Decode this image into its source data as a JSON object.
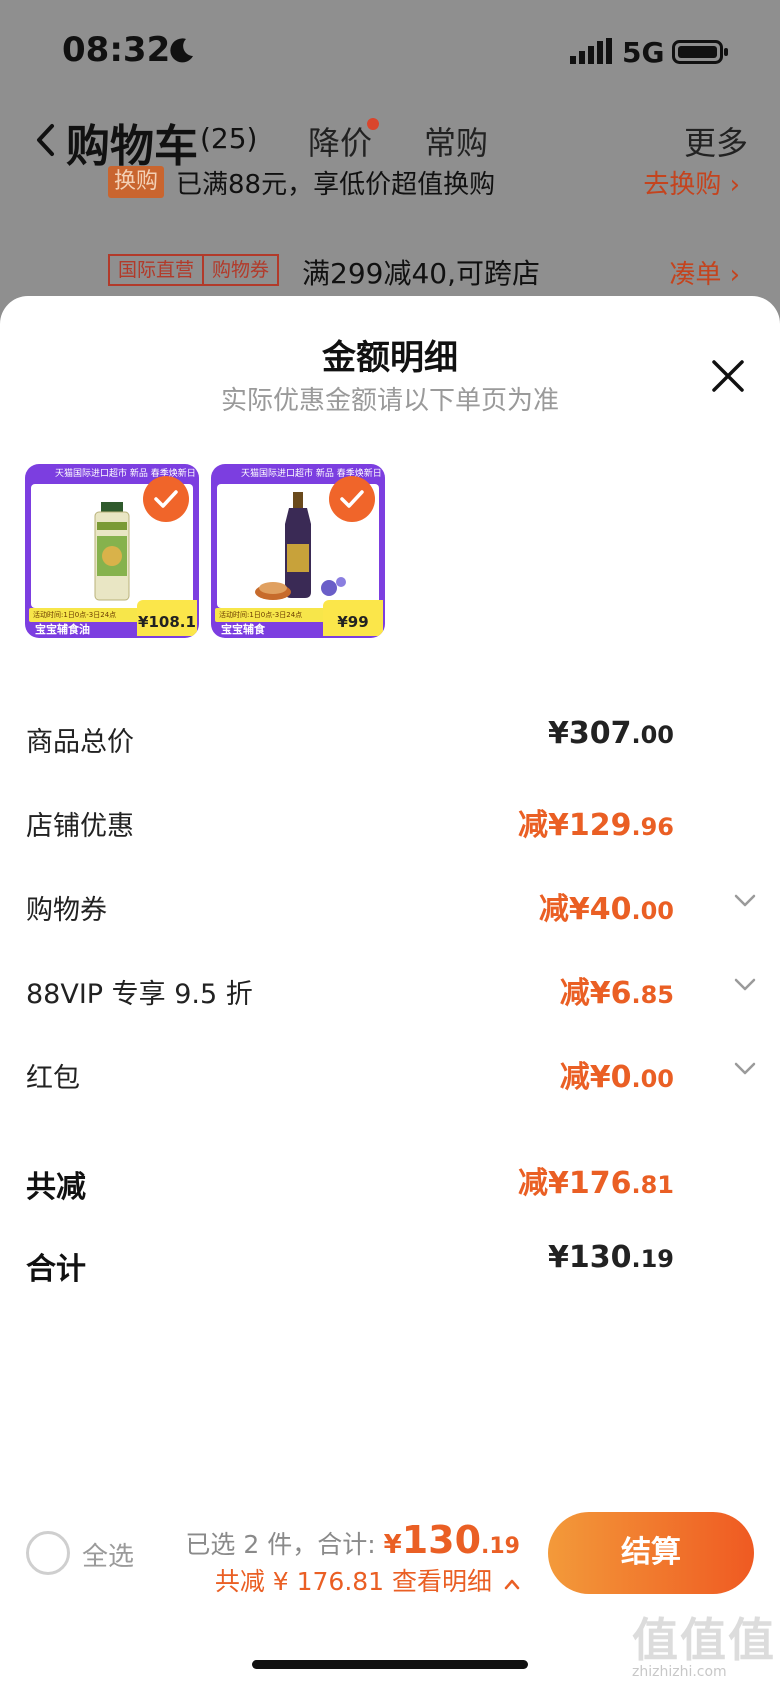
{
  "status_bar": {
    "time": "08:32",
    "network": "5G"
  },
  "cart_header": {
    "title": "购物车",
    "count": "(25)",
    "tabs": [
      "降价",
      "常购"
    ],
    "more": "更多"
  },
  "background_promos": {
    "exchange_tag": "换购",
    "exchange_text": "已满88元，享低价超值换购",
    "exchange_link": "去换购 ›",
    "chips": [
      "国际直营",
      "购物券"
    ],
    "coupon_text": "满299减40,可跨店",
    "coupon_link": "凑单 ›"
  },
  "sheet": {
    "title": "金额明细",
    "subtitle": "实际优惠金额请以下单页为准",
    "products": [
      {
        "header": "天猫国际进口超市 新品 春季焕新日",
        "promo": "活动时间:1日0点-3日24点",
        "category": "宝宝辅食油",
        "price": "108.1",
        "price_currency": "¥"
      },
      {
        "header": "天猫国际进口超市 新品 春季焕新日",
        "promo": "活动时间:1日0点-3日24点",
        "category": "宝宝辅食",
        "price": "99",
        "price_currency": "¥"
      }
    ],
    "rows": [
      {
        "label": "商品总价",
        "prefix": "",
        "main": "¥307",
        "dec": ".00"
      },
      {
        "label": "店铺优惠",
        "prefix": "减",
        "main": "¥129",
        "dec": ".96"
      },
      {
        "label": "购物券",
        "prefix": "减",
        "main": "¥40",
        "dec": ".00"
      },
      {
        "label": "88VIP 专享 9.5 折",
        "prefix": "减",
        "main": "¥6",
        "dec": ".85"
      },
      {
        "label": "红包",
        "prefix": "减",
        "main": "¥0",
        "dec": ".00"
      },
      {
        "label": "共减",
        "prefix": "减",
        "main": "¥176",
        "dec": ".81"
      },
      {
        "label": "合计",
        "prefix": "",
        "main": "¥130",
        "dec": ".19"
      }
    ]
  },
  "checkout_bar": {
    "select_all": "全选",
    "selected_text": "已选 2 件，合计: ",
    "total_currency": "¥",
    "total_main": "130",
    "total_dec": ".19",
    "discount_text": "共减 ¥ 176.81 查看明细",
    "checkout_label": "结算"
  },
  "watermark": {
    "mark": "值值值",
    "domain": "zhizhizhi.com"
  },
  "colors": {
    "accent_orange": "#ea5f24",
    "checkout_gradient_start": "#f39a3a",
    "checkout_gradient_end": "#ef5a22",
    "purple": "#7c3ee0"
  },
  "icons": [
    "moon-icon",
    "signal-icon",
    "battery-icon",
    "back-icon",
    "close-icon",
    "check-icon",
    "chevron-down-icon",
    "chevron-up-icon"
  ]
}
